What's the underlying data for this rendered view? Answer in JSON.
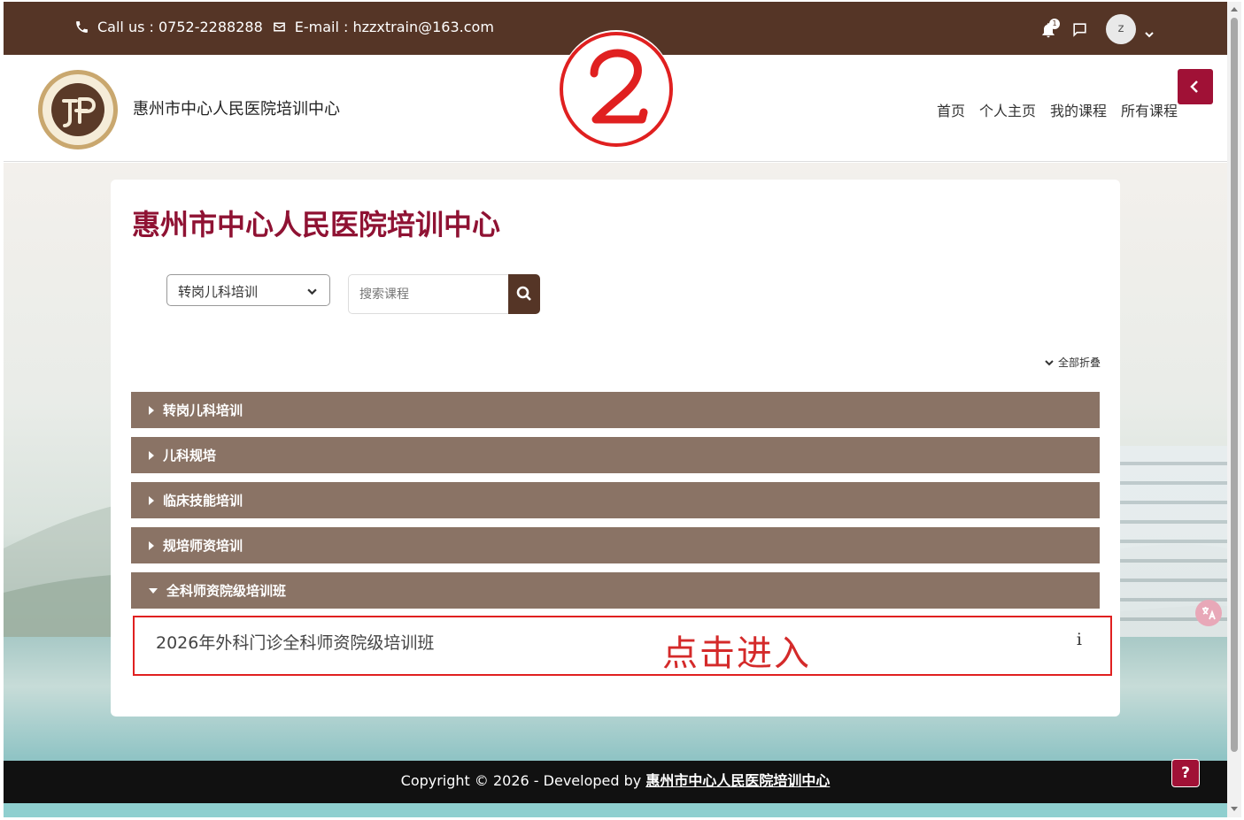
{
  "topbar": {
    "phone": "Call us : 0752-2288288",
    "email": "E-mail : hzzxtrain@163.com",
    "notification_count": "1",
    "user_initial": "z"
  },
  "header": {
    "site_name": "惠州市中心人民医院培训中心",
    "nav": [
      "首页",
      "个人主页",
      "我的课程",
      "所有课程"
    ]
  },
  "annotation": {
    "step_number": "②",
    "click_hint": "点击进入"
  },
  "main": {
    "title": "惠州市中心人民医院培训中心",
    "category_select": "转岗儿科培训",
    "search_placeholder": "搜索课程",
    "collapse_all": "全部折叠",
    "categories": [
      {
        "label": "转岗儿科培训",
        "expanded": false
      },
      {
        "label": "儿科规培",
        "expanded": false
      },
      {
        "label": "临床技能培训",
        "expanded": false
      },
      {
        "label": "规培师资培训",
        "expanded": false
      },
      {
        "label": "全科师资院级培训班",
        "expanded": true
      }
    ],
    "course": {
      "name": "2026年外科门诊全科师资院级培训班",
      "info": "i"
    }
  },
  "footer": {
    "text": "Copyright © 2026 - Developed by",
    "link": "惠州市中心人民医院培训中心",
    "help": "?"
  },
  "colors": {
    "brown": "#553526",
    "category_bar": "#8a7365",
    "accent_red": "#a01136",
    "title_red": "#8f1233",
    "annotation_red": "#d42a2a"
  }
}
